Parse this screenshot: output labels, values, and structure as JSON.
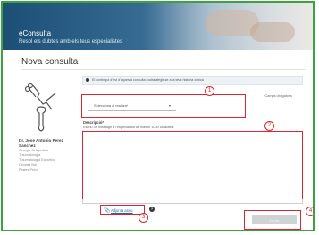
{
  "banner": {
    "title": "eConsulta",
    "subtitle": "Resol els dubtes amb els teus especialistes"
  },
  "page": {
    "title": "Nova consulta"
  },
  "info_bar": {
    "text": "El contingut d'est d'aquesta consulta podrà afegir-se a la teva història clínica"
  },
  "doctor": {
    "name": "Dr. Jose Antonio Perez Sanchez",
    "specialties": [
      "Cirurgia Ortopèdica",
      "Traumatologia",
      "Traumatologia Esportiva",
      "Cirurgia Mà",
      "Pilates Pelvi"
    ]
  },
  "form": {
    "required_note": "*Camps obligatoris",
    "specialty_select": {
      "value": "Selecciona ài realitza*",
      "arrow": "▾"
    },
    "description": {
      "label": "Descripció*",
      "help": "Escriu un missatge a l'especialista de màxim 1000 caràcters"
    },
    "attach_label": "Adjunta arxiu",
    "attach_icon": "paperclip-icon",
    "help_icon": "?",
    "send_label": "Enviar"
  },
  "callouts": [
    "1",
    "2",
    "3",
    "4"
  ],
  "colors": {
    "frame_border": "#3aa340",
    "highlight": "#d9262f",
    "banner": "#1c4e76",
    "link": "#2a5d9a"
  }
}
